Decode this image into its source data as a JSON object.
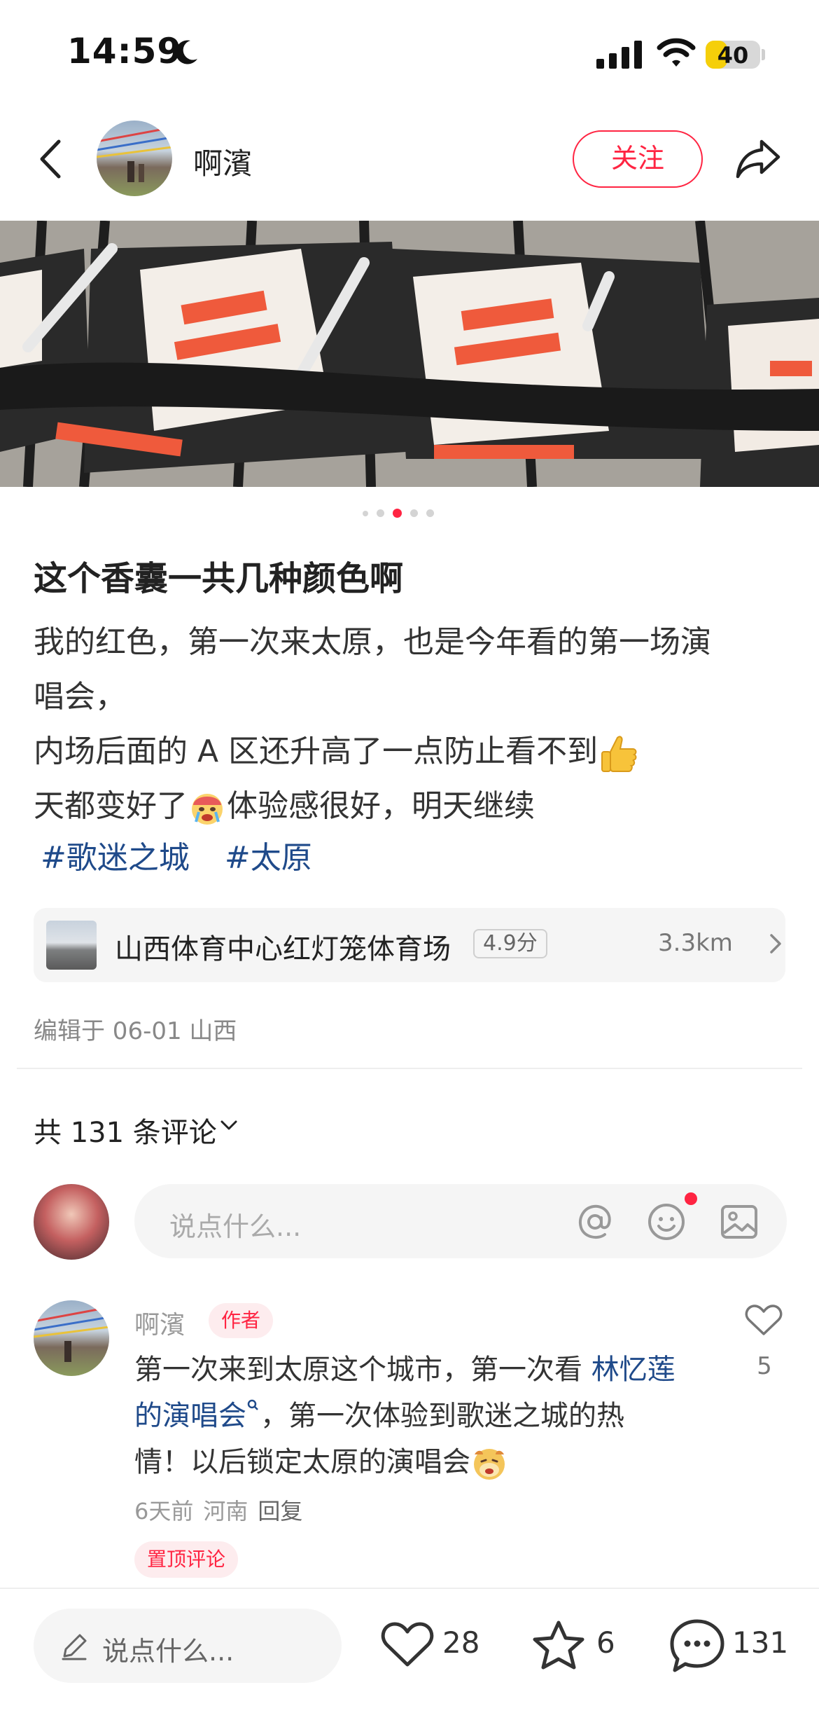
{
  "status_bar": {
    "time": "14:59",
    "battery": "40",
    "battery_level": 0.4
  },
  "header": {
    "author_name": "啊濱",
    "follow_label": "关注"
  },
  "carousel": {
    "total": 5,
    "active_index": 2
  },
  "post": {
    "title": "这个香囊一共几种颜色啊",
    "lines": [
      "我的红色，第一次来太原，也是今年看的第一场演",
      "唱会，",
      "内场后面的 A 区还升高了一点防止看不到",
      "天都变好了",
      "体验感很好，明天继续"
    ],
    "tags": [
      "#歌迷之城",
      "#太原"
    ]
  },
  "location": {
    "name": "山西体育中心红灯笼体育场",
    "rating": "4.9分",
    "distance": "3.3km"
  },
  "edit_meta": "编辑于 06-01 山西",
  "comments_header": {
    "label": "共 131 条评论"
  },
  "comment_input": {
    "placeholder": "说点什么..."
  },
  "comment": {
    "user": "啊濱",
    "badge": "作者",
    "text_1": "第一次来到太原这个城市，第一次看 ",
    "link_1": "林忆莲",
    "link_2": "的演唱会",
    "text_2": "，第一次体验到歌迷之城的热",
    "text_3": "情！以后锁定太原的演唱会",
    "time": "6天前",
    "region": "河南",
    "reply": "回复",
    "likes": "5",
    "pinned": "置顶评论"
  },
  "bottom_bar": {
    "placeholder": "说点什么...",
    "likes": "28",
    "stars": "6",
    "comments": "131"
  },
  "colors": {
    "accent": "#ff2442",
    "link": "#1f4a8a"
  },
  "icons": [
    "back-icon",
    "share-icon",
    "at-icon",
    "smile-icon",
    "image-icon",
    "heart-icon",
    "star-icon",
    "comment-icon",
    "pen-icon",
    "chevron-right-icon",
    "chevron-down-icon",
    "thumbs-up-emoji",
    "crying-emoji",
    "laughing-emoji"
  ]
}
